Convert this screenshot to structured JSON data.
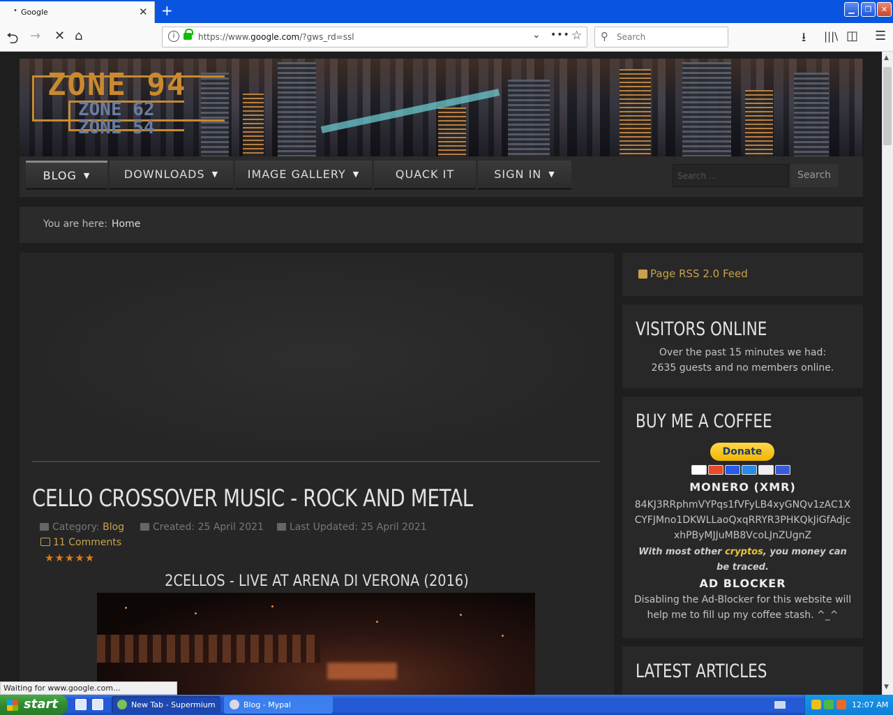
{
  "browser": {
    "tab_title": "Google",
    "tab_close": "✕",
    "new_tab": "+",
    "url_prefix": "https://www.",
    "url_host": "google.com",
    "url_path": "/?gws_rd=ssl",
    "search_placeholder": "Search",
    "status_text": "Waiting for www.google.com...",
    "icons": [
      "back-icon",
      "forward-icon",
      "stop-icon",
      "home-icon",
      "info-icon",
      "lock-icon",
      "chevron-down-icon",
      "more-icon",
      "bookmark-star-icon",
      "search-icon",
      "download-icon",
      "library-icon",
      "sidebar-icon",
      "menu-icon"
    ]
  },
  "site": {
    "logo_main": "ZONE 94",
    "logo_sub1": "ZONE 62",
    "logo_sub2": "ZONE 54",
    "menu": [
      {
        "label": "BLOG",
        "has_caret": true,
        "active": true
      },
      {
        "label": "DOWNLOADS",
        "has_caret": true,
        "active": false
      },
      {
        "label": "IMAGE GALLERY",
        "has_caret": true,
        "active": false
      },
      {
        "label": "QUACK IT",
        "has_caret": false,
        "active": false
      },
      {
        "label": "SIGN IN",
        "has_caret": true,
        "active": false
      }
    ],
    "search_placeholder": "Search ...",
    "search_button": "Search",
    "breadcrumb_label": "You are here:",
    "breadcrumb_home": "Home"
  },
  "article": {
    "title": "CELLO CROSSOVER MUSIC - ROCK AND METAL",
    "category_label": "Category:",
    "category": "Blog",
    "created": "Created: 25 April 2021",
    "updated": "Last Updated: 25 April 2021",
    "comments": "11 Comments",
    "rating_stars": "★★★★★",
    "video_title": "2CELLOS - LIVE AT ARENA DI VERONA (2016)"
  },
  "sidebar": {
    "rss": "Page RSS 2.0 Feed",
    "visitors_title": "VISITORS ONLINE",
    "visitors_line1": "Over the past 15 minutes we had:",
    "visitors_line2": "2635 guests and no members online.",
    "coffee_title": "BUY ME A COFFEE",
    "donate": "Donate",
    "monero_title": "MONERO (XMR)",
    "monero_address": "84KJ3RRphmVYPqs1fVFyLB4xyGNQv1zAC1XCYFJMno1DKWLLaoQxqRRYR3PHKQkJiGfAdjcxhPByMJJuMB8VcoLJnZUgnZ",
    "monero_note_pre": "With most other ",
    "monero_note_link": "cryptos",
    "monero_note_post": ", you money can be traced.",
    "adblock_title": "AD BLOCKER",
    "adblock_text": "Disabling the Ad-Blocker for this website will help me to fill up my coffee stash. ^_^",
    "latest_title": "LATEST ARTICLES"
  },
  "taskbar": {
    "start": "start",
    "task1": "New Tab - Supermium",
    "task2": "Blog - Mypal",
    "clock": "12:07 AM"
  },
  "colors": {
    "accent_gold": "#c9a24a",
    "logo_orange": "#c98a2f",
    "star_orange": "#e07a10",
    "xp_blue": "#245bd8"
  }
}
